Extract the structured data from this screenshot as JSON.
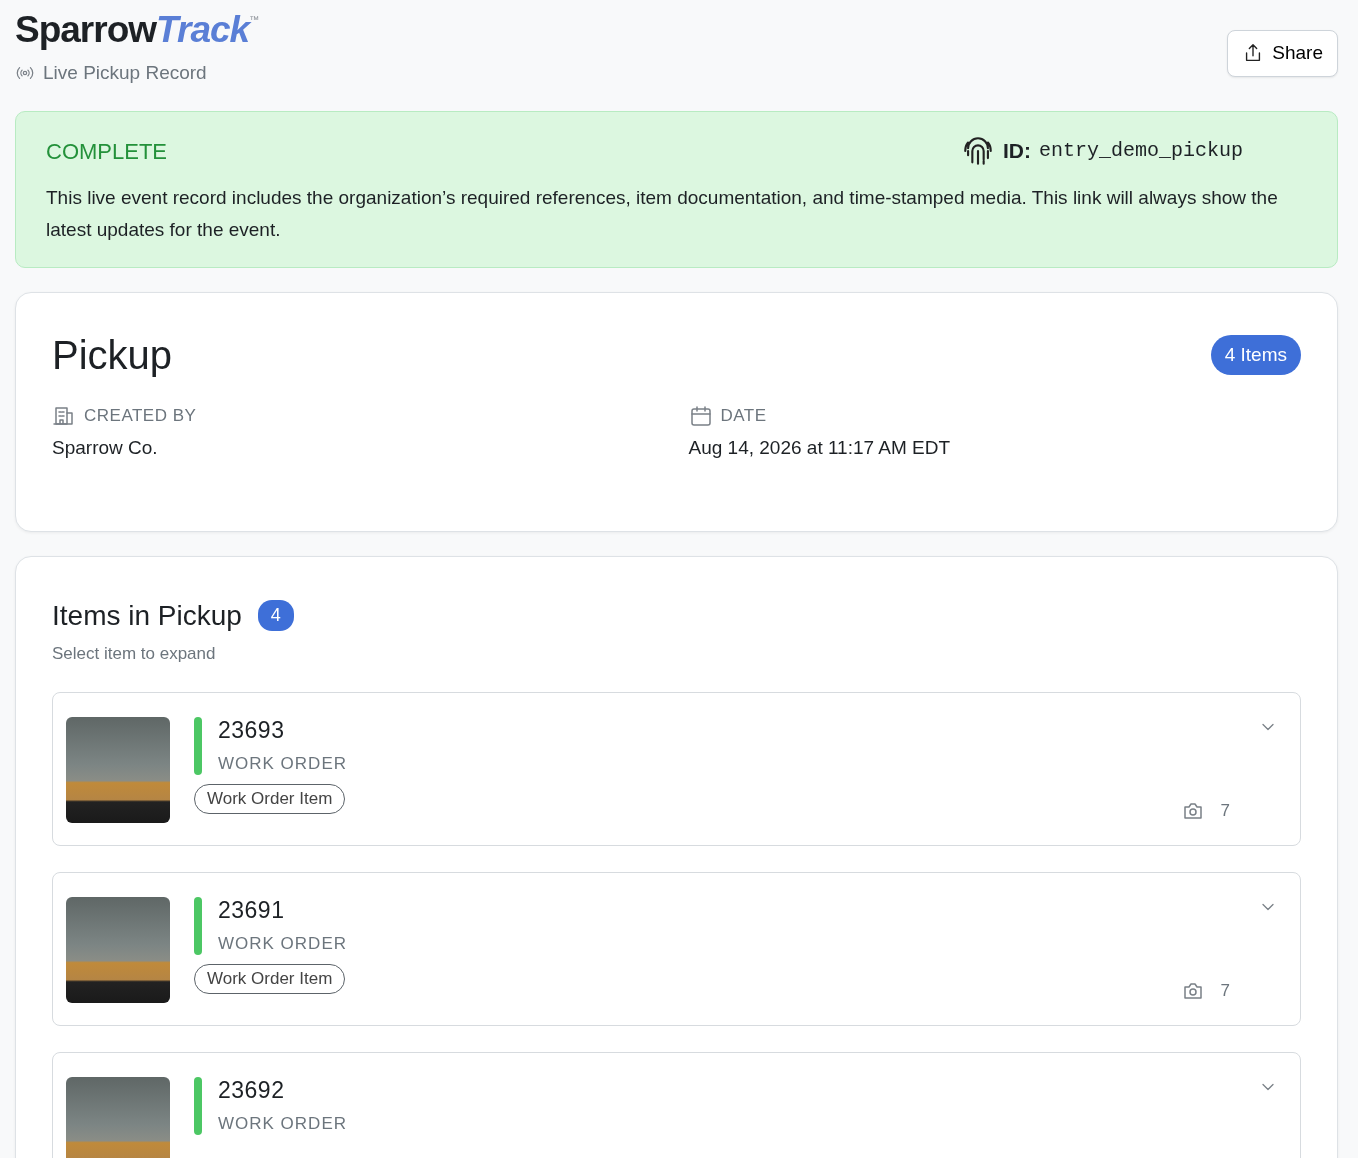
{
  "header": {
    "logo_primary": "Sparrow",
    "logo_accent": "Track",
    "logo_mark": "™",
    "subtitle": "Live Pickup Record",
    "share_button": "Share"
  },
  "status_banner": {
    "status": "COMPLETE",
    "id_label": "ID:",
    "id_value": "entry_demo_pickup",
    "description": "This live event record includes the organization’s required references, item documentation, and time-stamped media. This link will always show the latest updates for the event."
  },
  "summary": {
    "title": "Pickup",
    "item_count_badge": "4 Items",
    "fields": [
      {
        "kind": "building",
        "label": "CREATED BY",
        "value": "Sparrow Co."
      },
      {
        "kind": "calendar",
        "label": "DATE",
        "value": "Aug 14, 2026 at 11:17 AM EDT"
      }
    ]
  },
  "items_section": {
    "title": "Items in Pickup",
    "count": "4",
    "hint": "Select item to expand",
    "items": [
      {
        "number": "23693",
        "type": "WORK ORDER",
        "tag": "Work Order Item",
        "photo_count": "7",
        "color": "#4cc764",
        "expanded": false
      },
      {
        "number": "23691",
        "type": "WORK ORDER",
        "tag": "Work Order Item",
        "photo_count": "7",
        "color": "#4cc764",
        "expanded": false
      },
      {
        "number": "23692",
        "type": "WORK ORDER",
        "color": "#4cc764",
        "expanded": false
      }
    ]
  }
}
